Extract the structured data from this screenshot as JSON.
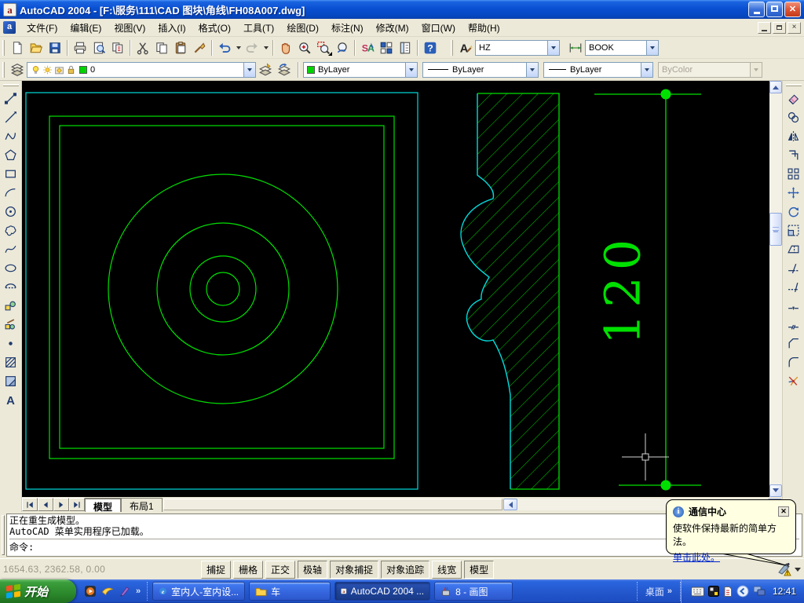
{
  "window": {
    "title": "AutoCAD 2004 - [F:\\服务\\111\\CAD 图块\\角线\\FH08A007.dwg]"
  },
  "menu": {
    "items": [
      "文件(F)",
      "编辑(E)",
      "视图(V)",
      "插入(I)",
      "格式(O)",
      "工具(T)",
      "绘图(D)",
      "标注(N)",
      "修改(M)",
      "窗口(W)",
      "帮助(H)"
    ]
  },
  "toolbars": {
    "standard_icons": [
      "new",
      "open",
      "save",
      "plot",
      "plot-preview",
      "publish",
      "cut",
      "copy",
      "paste",
      "match-properties",
      "undo",
      "redo",
      "pan-realtime",
      "zoom-realtime",
      "zoom-window",
      "zoom-previous",
      "properties",
      "designcenter",
      "tool-palettes",
      "help"
    ],
    "text_style": "HZ",
    "dim_style": "BOOK",
    "layer": {
      "name": "0",
      "swatch_color": "#00D400",
      "state_icons": [
        "bulb-on",
        "sun",
        "sun-viewport",
        "lock"
      ]
    },
    "color": "ByLayer",
    "linetype": "ByLayer",
    "lineweight": "ByLayer",
    "plot_style": "ByColor"
  },
  "draw_toolbar_icons": [
    "line",
    "construction-line",
    "polyline",
    "polygon",
    "rectangle",
    "arc",
    "circle",
    "revision-cloud",
    "spline",
    "ellipse",
    "ellipse-arc",
    "insert-block",
    "make-block",
    "point",
    "hatch",
    "region",
    "multiline-text"
  ],
  "modify_toolbar_icons": [
    "erase",
    "copy-object",
    "mirror",
    "offset",
    "array",
    "move",
    "rotate",
    "scale",
    "stretch",
    "trim",
    "extend",
    "break-at-point",
    "break",
    "chamfer",
    "fillet",
    "explode"
  ],
  "canvas": {
    "dimension_text": "120",
    "colors": {
      "geometry": "#00E000",
      "profile_outline": "#00DCDC",
      "background": "#000000"
    }
  },
  "layout_tabs": {
    "tabs": [
      "模型",
      "布局1"
    ],
    "active": "模型"
  },
  "command_line": {
    "history": [
      "正在重生成模型。",
      "AutoCAD 菜单实用程序已加载。"
    ],
    "prompt": "命令:"
  },
  "status_bar": {
    "coordinates": "1654.63, 2362.58, 0.00",
    "toggles": [
      {
        "label": "捕捉",
        "pressed": false
      },
      {
        "label": "栅格",
        "pressed": false
      },
      {
        "label": "正交",
        "pressed": false
      },
      {
        "label": "极轴",
        "pressed": true
      },
      {
        "label": "对象捕捉",
        "pressed": true
      },
      {
        "label": "对象追踪",
        "pressed": true
      },
      {
        "label": "线宽",
        "pressed": false
      },
      {
        "label": "模型",
        "pressed": true
      }
    ]
  },
  "balloon": {
    "title": "通信中心",
    "body": "使软件保持最新的简单方法。",
    "link": "单击此处。"
  },
  "taskbar": {
    "start": "开始",
    "tasks": [
      "室内人-室内设...",
      "车",
      "AutoCAD 2004 ...",
      "8 - 画图"
    ],
    "active_task": "AutoCAD 2004 ...",
    "desktop_label": "桌面",
    "clock": "12:41"
  }
}
